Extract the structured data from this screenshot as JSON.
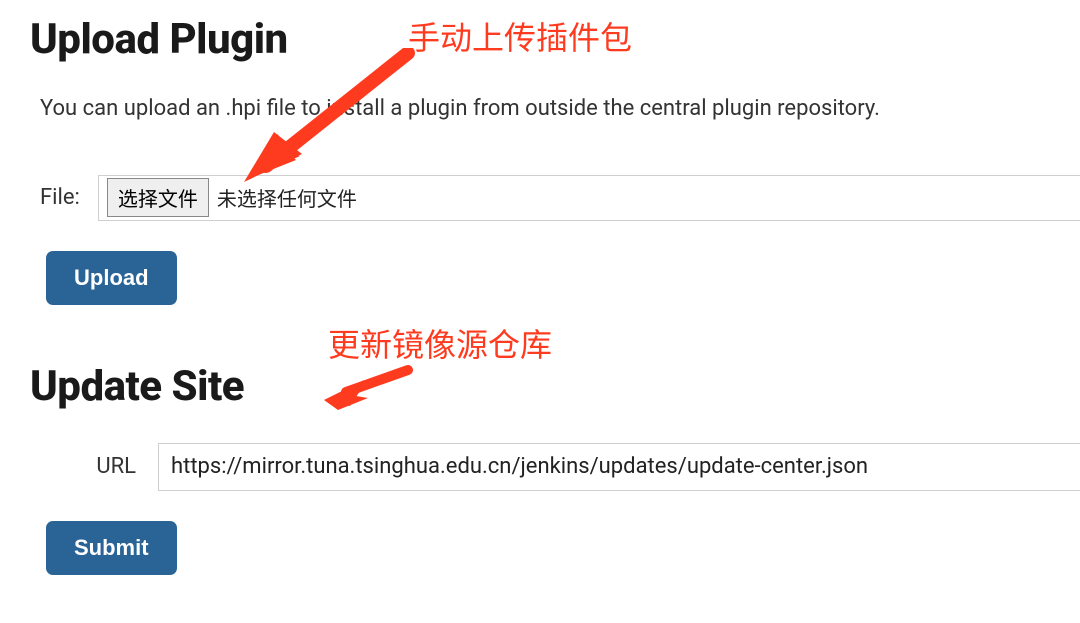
{
  "upload": {
    "heading": "Upload Plugin",
    "description": "You can upload an .hpi file to install a plugin from outside the central plugin repository.",
    "file_label": "File:",
    "choose_button": "选择文件",
    "file_status": "未选择任何文件",
    "upload_button": "Upload"
  },
  "update": {
    "heading": "Update Site",
    "url_label": "URL",
    "url_value": "https://mirror.tuna.tsinghua.edu.cn/jenkins/updates/update-center.json",
    "submit_button": "Submit"
  },
  "annotations": {
    "a1": "手动上传插件包",
    "a2": "更新镜像源仓库"
  },
  "colors": {
    "annotation": "#ff3b1f",
    "primary_button_bg": "#2a6496"
  }
}
